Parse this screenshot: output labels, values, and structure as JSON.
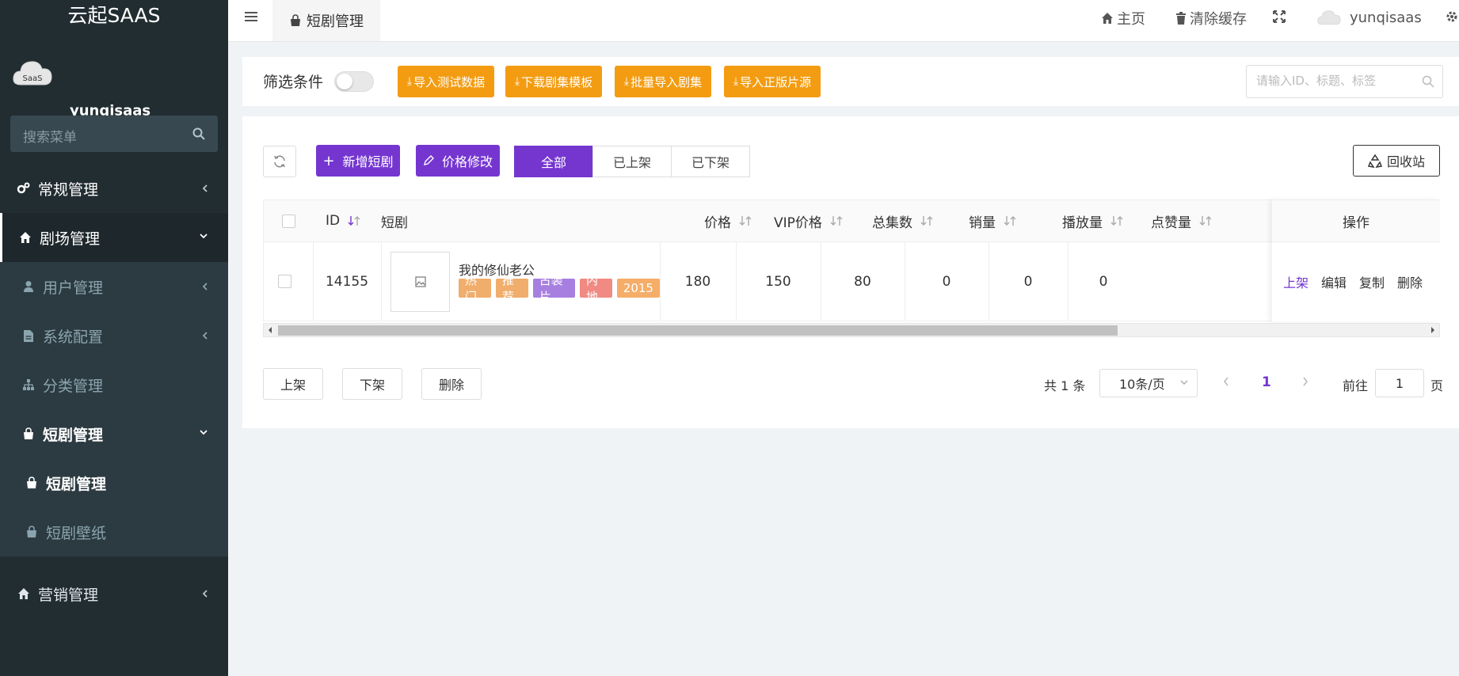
{
  "app": {
    "brand": "云起SAAS"
  },
  "user": {
    "name": "yunqisaas",
    "avatar_text": "SaaS"
  },
  "sidebar": {
    "search_placeholder": "搜索菜单",
    "items": [
      {
        "label": "常规管理"
      },
      {
        "label": "剧场管理"
      },
      {
        "label": "用户管理"
      },
      {
        "label": "系统配置"
      },
      {
        "label": "分类管理"
      },
      {
        "label": "短剧管理"
      },
      {
        "label": "短剧管理"
      },
      {
        "label": "短剧壁纸"
      },
      {
        "label": "营销管理"
      }
    ]
  },
  "header": {
    "tab_title": "短剧管理",
    "home": "主页",
    "clear_cache": "清除缓存",
    "username": "yunqisaas"
  },
  "filter": {
    "label": "筛选条件",
    "buttons": [
      "导入测试数据",
      "下载剧集模板",
      "批量导入剧集",
      "导入正版片源"
    ],
    "search_placeholder": "请输入ID、标题、标签"
  },
  "toolbar": {
    "add": "新增短剧",
    "price_edit": "价格修改",
    "segments": [
      "全部",
      "已上架",
      "已下架"
    ],
    "recycle": "回收站"
  },
  "table": {
    "headers": {
      "id": "ID",
      "drama": "短剧",
      "price": "价格",
      "vip_price": "VIP价格",
      "episodes": "总集数",
      "sales": "销量",
      "plays": "播放量",
      "likes": "点赞量",
      "ops": "操作"
    },
    "rows": [
      {
        "id": "14155",
        "title": "我的修仙老公",
        "tags": [
          "热门",
          "推荐",
          "古装片",
          "内地",
          "2015"
        ],
        "price": "180",
        "vip_price": "150",
        "episodes": "80",
        "sales": "0",
        "plays": "0",
        "likes": "0",
        "ops": [
          "上架",
          "编辑",
          "复制",
          "删除"
        ]
      }
    ]
  },
  "bulk": {
    "on": "上架",
    "off": "下架",
    "delete": "删除"
  },
  "pager": {
    "total": "共 1 条",
    "page_size": "10条/页",
    "page": "1",
    "goto": "前往",
    "goto_value": "1",
    "unit": "页"
  },
  "colors": {
    "sidebar": "#222d32",
    "accent": "#7536d0",
    "orange": "#f39c12"
  }
}
